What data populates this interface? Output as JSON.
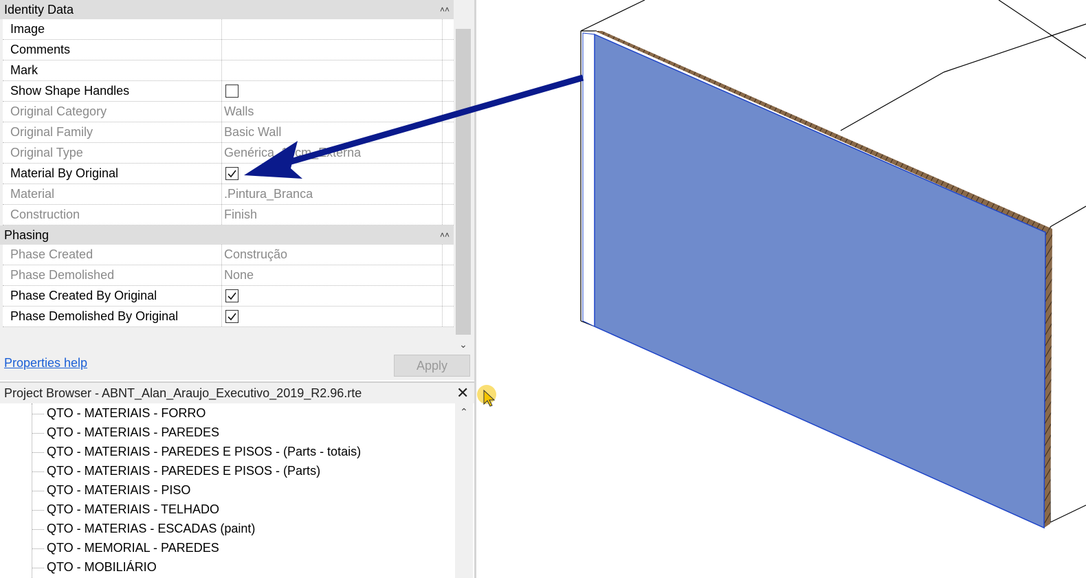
{
  "properties": {
    "identity_section": "Identity Data",
    "identity_rows": [
      {
        "label": "Image",
        "value": "",
        "kind": "text",
        "readonly": false
      },
      {
        "label": "Comments",
        "value": "",
        "kind": "text",
        "readonly": false
      },
      {
        "label": "Mark",
        "value": "",
        "kind": "text",
        "readonly": false
      },
      {
        "label": "Show Shape Handles",
        "value": "",
        "kind": "checkbox",
        "checked": false,
        "readonly": false
      },
      {
        "label": "Original Category",
        "value": "Walls",
        "kind": "text",
        "readonly": true
      },
      {
        "label": "Original Family",
        "value": "Basic Wall",
        "kind": "text",
        "readonly": true
      },
      {
        "label": "Original Type",
        "value": "Genérica_15cm_Externa",
        "kind": "text",
        "readonly": true
      },
      {
        "label": "Material By Original",
        "value": "",
        "kind": "checkbox",
        "checked": true,
        "readonly": false
      },
      {
        "label": "Material",
        "value": ".Pintura_Branca",
        "kind": "text",
        "readonly": true
      },
      {
        "label": "Construction",
        "value": "Finish",
        "kind": "text",
        "readonly": true
      }
    ],
    "phasing_section": "Phasing",
    "phasing_rows": [
      {
        "label": "Phase Created",
        "value": "Construção",
        "kind": "text",
        "readonly": true
      },
      {
        "label": "Phase Demolished",
        "value": "None",
        "kind": "text",
        "readonly": true
      },
      {
        "label": "Phase Created By Original",
        "value": "",
        "kind": "checkbox",
        "checked": true,
        "readonly": false
      },
      {
        "label": "Phase Demolished By Original",
        "value": "",
        "kind": "checkbox",
        "checked": true,
        "readonly": false
      }
    ],
    "help_link": "Properties help",
    "apply_label": "Apply"
  },
  "project_browser": {
    "title": "Project Browser - ABNT_Alan_Araujo_Executivo_2019_R2.96.rte",
    "close_icon": "close-icon",
    "items": [
      "QTO - MATERIAIS - FORRO",
      "QTO - MATERIAIS - PAREDES",
      "QTO - MATERIAIS - PAREDES E PISOS - (Parts - totais)",
      "QTO - MATERIAIS - PAREDES E PISOS - (Parts)",
      "QTO - MATERIAIS - PISO",
      "QTO - MATERIAIS - TELHADO",
      "QTO - MATERIAS - ESCADAS (paint)",
      "QTO - MEMORIAL - PAREDES",
      "QTO - MOBILIÁRIO"
    ]
  },
  "viewport": {
    "wall_face_color": "#6f8bcc",
    "wall_edge_color": "#1f45c8",
    "layer_color": "#8a6a4a",
    "annotation_arrow_color": "#0a1a8c"
  },
  "colors": {
    "link": "#1a5fd6",
    "readonly_text": "#8a8a8a",
    "cursor_highlight": "#f5c400"
  }
}
